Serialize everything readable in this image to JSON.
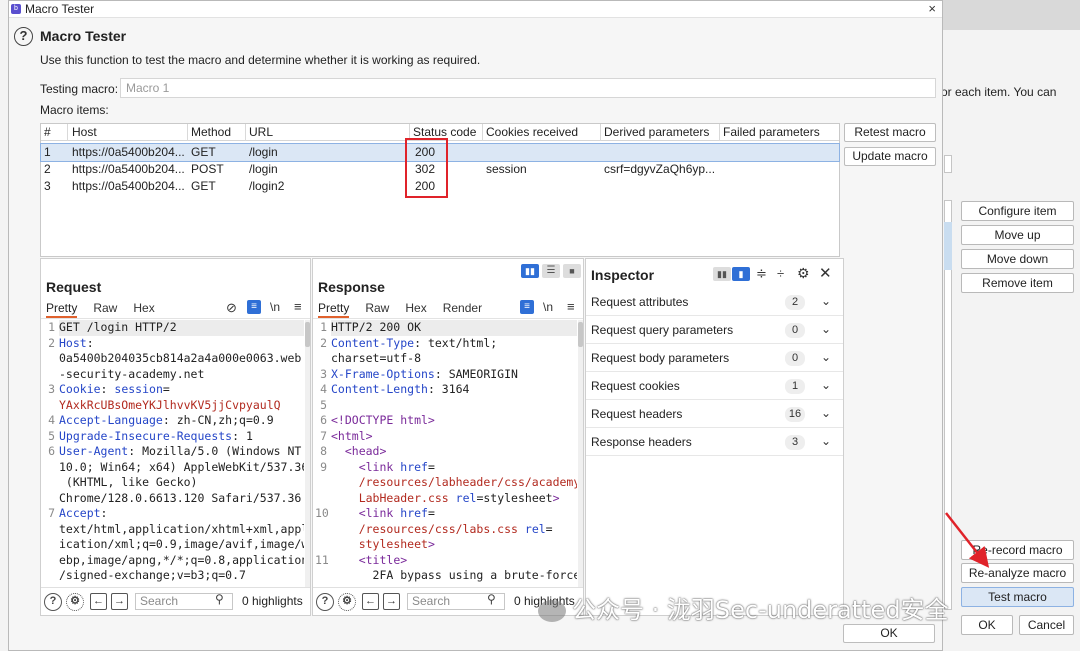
{
  "window": {
    "title": "Macro Tester",
    "close": "×"
  },
  "header": {
    "title": "Macro Tester",
    "description": "Use this function to test the macro and determine whether it is working as required.",
    "testing_label": "Testing macro:",
    "testing_value": "Macro 1",
    "items_label": "Macro items:"
  },
  "macro_items": {
    "columns": [
      "#",
      "Host",
      "Method",
      "URL",
      "Status code",
      "Cookies received",
      "Derived parameters",
      "Failed parameters"
    ],
    "rows": [
      {
        "n": "1",
        "host": "https://0a5400b204...",
        "method": "GET",
        "url": "/login",
        "status": "200",
        "cookies": "",
        "derived": "",
        "failed": ""
      },
      {
        "n": "2",
        "host": "https://0a5400b204...",
        "method": "POST",
        "url": "/login",
        "status": "302",
        "cookies": "session",
        "derived": "csrf=dgyvZaQh6yp...",
        "failed": ""
      },
      {
        "n": "3",
        "host": "https://0a5400b204...",
        "method": "GET",
        "url": "/login2",
        "status": "200",
        "cookies": "",
        "derived": "",
        "failed": ""
      }
    ],
    "selected_row": 1
  },
  "buttons": {
    "retest": "Retest macro",
    "update": "Update macro",
    "ok": "OK"
  },
  "request": {
    "title": "Request",
    "tabs": [
      "Pretty",
      "Raw",
      "Hex"
    ],
    "wrap_icon": "\\n",
    "search_placeholder": "Search",
    "highlights": "0 highlights"
  },
  "response": {
    "title": "Response",
    "tabs": [
      "Pretty",
      "Raw",
      "Hex",
      "Render"
    ],
    "wrap_icon": "\\n",
    "search_placeholder": "Search",
    "highlights": "0 highlights"
  },
  "inspector": {
    "title": "Inspector",
    "rows": [
      {
        "label": "Request attributes",
        "count": "2"
      },
      {
        "label": "Request query parameters",
        "count": "0"
      },
      {
        "label": "Request body parameters",
        "count": "0"
      },
      {
        "label": "Request cookies",
        "count": "1"
      },
      {
        "label": "Request headers",
        "count": "16"
      },
      {
        "label": "Response headers",
        "count": "3"
      }
    ]
  },
  "background_dialog": {
    "text": "or each item. You can",
    "buttons": [
      "Configure item",
      "Move up",
      "Move down",
      "Remove item",
      "Re-record macro",
      "Re-analyze macro",
      "Test macro",
      "OK",
      "Cancel"
    ]
  },
  "watermark": "公众号 · 泷羽Sec-underatted安全",
  "colors": {
    "accent": "#e0612d",
    "annotation_red": "#e0232a",
    "selection": "#dbe7f5",
    "header_key": "#2546c8",
    "value": "#b22a1f"
  }
}
